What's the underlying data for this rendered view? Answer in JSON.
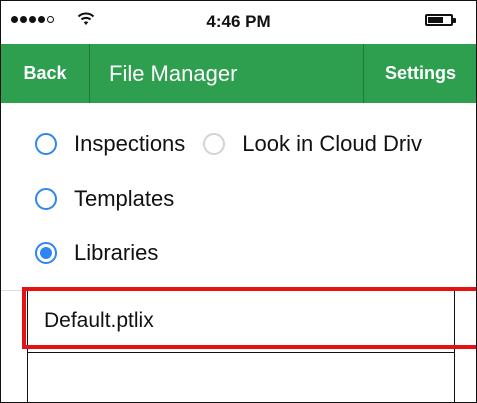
{
  "status_bar": {
    "time": "4:46 PM",
    "signal_bars_filled": 4,
    "signal_bars_total": 5,
    "signal_icon": "signal-dots-icon",
    "wifi_icon": "wifi-icon",
    "battery_icon": "battery-icon",
    "battery_level_fraction": 0.7
  },
  "navbar": {
    "back_label": "Back",
    "title": "File Manager",
    "settings_label": "Settings",
    "background_color": "#2e9e4f"
  },
  "source_options": {
    "inspections": {
      "label": "Inspections",
      "checked": false
    },
    "cloud_drive": {
      "label": "Look in Cloud Driv",
      "checked": false,
      "disabled": true
    },
    "templates": {
      "label": "Templates",
      "checked": false
    },
    "libraries": {
      "label": "Libraries",
      "checked": true
    },
    "accent_color": "#2f86f0"
  },
  "file_list": {
    "items": [
      {
        "name": "Default.ptlix"
      }
    ]
  },
  "annotation": {
    "highlight_color": "#e41212"
  }
}
